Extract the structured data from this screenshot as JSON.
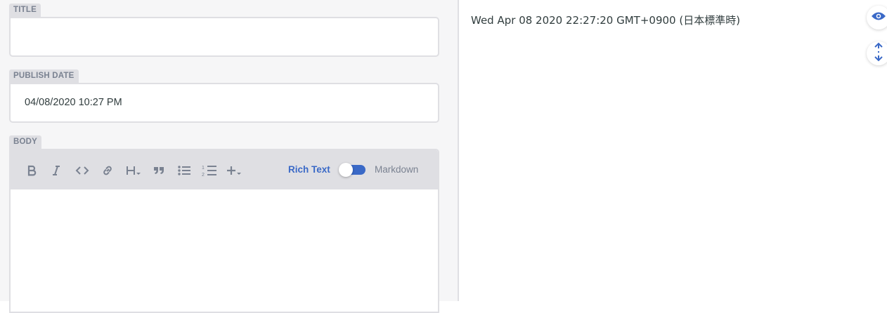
{
  "fields": {
    "title": {
      "label": "TITLE",
      "value": ""
    },
    "publish_date": {
      "label": "PUBLISH DATE",
      "value": "04/08/2020 10:27 PM"
    },
    "body": {
      "label": "BODY",
      "value": ""
    }
  },
  "toolbar": {
    "buttons": [
      "bold-icon",
      "italic-icon",
      "code-icon",
      "link-icon",
      "heading-icon",
      "quote-icon",
      "bulleted-list-icon",
      "numbered-list-icon",
      "add-component-icon"
    ],
    "rich_text_label": "Rich Text",
    "markdown_label": "Markdown",
    "mode": "Rich Text"
  },
  "preview": {
    "date_text": "Wed Apr 08 2020 22:27:20 GMT+0900 (日本標準時)"
  },
  "side_buttons": [
    "eye-icon",
    "scroll-sync-icon"
  ],
  "colors": {
    "accent": "#3a69c7",
    "label_bg": "#dfdfe3",
    "label_text": "#7a8291",
    "text": "#313d3e"
  }
}
